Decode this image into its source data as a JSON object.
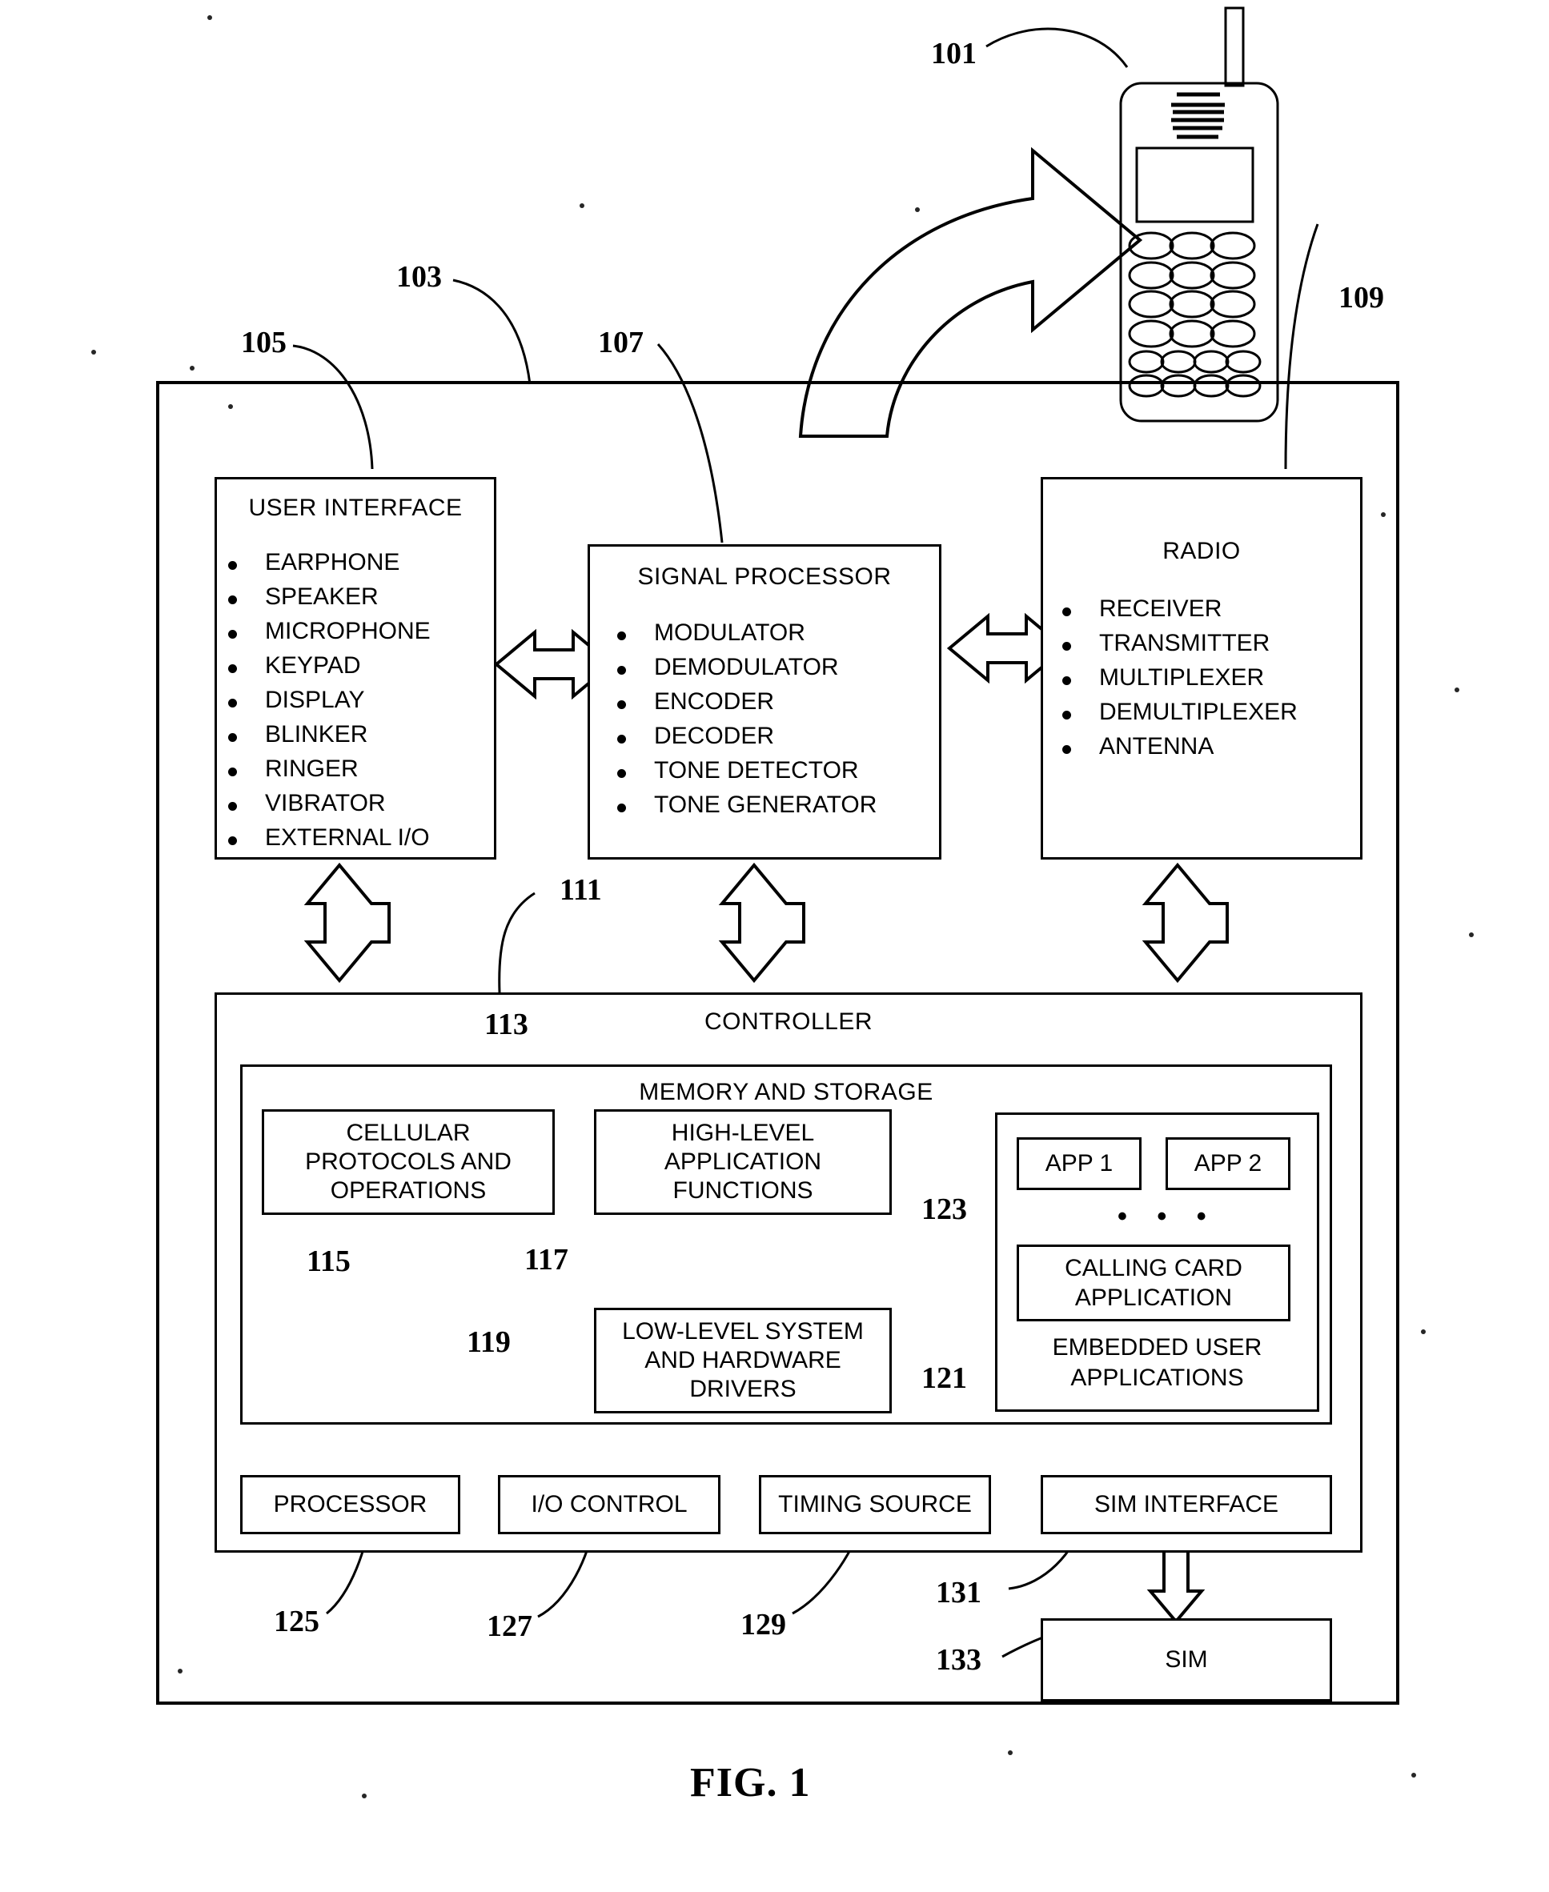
{
  "figure": {
    "caption": "FIG. 1",
    "refs": {
      "phone": "101",
      "device": "103",
      "user_interface": "105",
      "signal_processor": "107",
      "radio": "109",
      "controller": "111",
      "memory_and_storage": "113",
      "cellular_protocols": "115",
      "high_level_app": "117",
      "low_level_drivers": "119",
      "embedded_user_applications": "121",
      "calling_card_application": "123",
      "processor": "125",
      "io_control": "127",
      "timing_source": "129",
      "sim_interface": "131",
      "sim": "133"
    }
  },
  "blocks": {
    "user_interface": {
      "title": "USER INTERFACE",
      "items": [
        "EARPHONE",
        "SPEAKER",
        "MICROPHONE",
        "KEYPAD",
        "DISPLAY",
        "BLINKER",
        "RINGER",
        "VIBRATOR",
        "EXTERNAL I/O"
      ]
    },
    "signal_processor": {
      "title": "SIGNAL PROCESSOR",
      "items": [
        "MODULATOR",
        "DEMODULATOR",
        "ENCODER",
        "DECODER",
        "TONE DETECTOR",
        "TONE GENERATOR"
      ]
    },
    "radio": {
      "title": "RADIO",
      "items": [
        "RECEIVER",
        "TRANSMITTER",
        "MULTIPLEXER",
        "DEMULTIPLEXER",
        "ANTENNA"
      ]
    },
    "controller": {
      "title": "CONTROLLER"
    },
    "memory_and_storage": {
      "title": "MEMORY AND STORAGE"
    },
    "cellular_protocols": {
      "title": "CELLULAR PROTOCOLS AND OPERATIONS"
    },
    "high_level_app": {
      "title": "HIGH-LEVEL APPLICATION FUNCTIONS"
    },
    "low_level_drivers": {
      "title": "LOW-LEVEL SYSTEM AND HARDWARE DRIVERS"
    },
    "embedded_user_applications": {
      "title": "EMBEDDED USER APPLICATIONS",
      "app1": "APP 1",
      "app2": "APP 2",
      "ellipsis": "• • •",
      "calling_card": "CALLING CARD APPLICATION"
    },
    "processor": {
      "title": "PROCESSOR"
    },
    "io_control": {
      "title": "I/O CONTROL"
    },
    "timing_source": {
      "title": "TIMING SOURCE"
    },
    "sim_interface": {
      "title": "SIM INTERFACE"
    },
    "sim": {
      "title": "SIM"
    }
  },
  "icons": {
    "mobile_phone": "mobile-phone-icon",
    "bold_curved_arrow": "curved-arrow-icon",
    "bidirectional_arrow": "double-headed-arrow-icon"
  },
  "colors": {
    "ink": "#000000",
    "paper": "#ffffff"
  }
}
